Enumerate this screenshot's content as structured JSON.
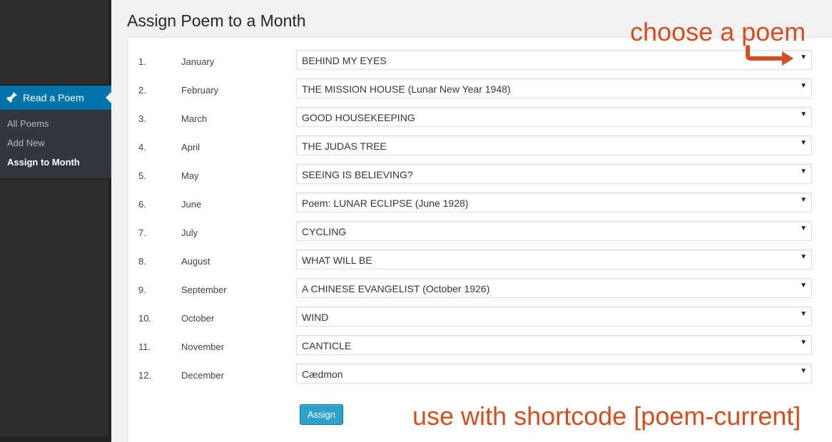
{
  "sidebar": {
    "menu_label": "Read a Poem",
    "submenu": [
      {
        "label": "All Poems"
      },
      {
        "label": "Add New"
      },
      {
        "label": "Assign to Month"
      }
    ]
  },
  "page": {
    "title": "Assign Poem to a Month",
    "assign_label": "Assign"
  },
  "rows": [
    {
      "num": "1.",
      "month": "January",
      "poem": "BEHIND MY EYES"
    },
    {
      "num": "2.",
      "month": "February",
      "poem": "THE MISSION HOUSE (Lunar New Year 1948)"
    },
    {
      "num": "3.",
      "month": "March",
      "poem": "GOOD HOUSEKEEPING"
    },
    {
      "num": "4.",
      "month": "April",
      "poem": "THE JUDAS TREE"
    },
    {
      "num": "5.",
      "month": "May",
      "poem": "SEEING IS BELIEVING?"
    },
    {
      "num": "6.",
      "month": "June",
      "poem": "Poem: LUNAR ECLIPSE (June 1928)"
    },
    {
      "num": "7.",
      "month": "July",
      "poem": "CYCLING"
    },
    {
      "num": "8.",
      "month": "August",
      "poem": "WHAT WILL BE"
    },
    {
      "num": "9.",
      "month": "September",
      "poem": "A CHINESE EVANGELIST (October 1926)"
    },
    {
      "num": "10.",
      "month": "October",
      "poem": "WIND"
    },
    {
      "num": "11.",
      "month": "November",
      "poem": "CANTICLE"
    },
    {
      "num": "12.",
      "month": "December",
      "poem": "Cædmon"
    }
  ],
  "annotations": {
    "choose": "choose a poem",
    "shortcode": "use with shortcode [poem-current]"
  },
  "colors": {
    "accent": "#0073aa",
    "button": "#2ea2cc",
    "annotation": "#d54e21"
  },
  "icons": {
    "menu": "pin-icon",
    "select": "dropdown-arrow-icon"
  }
}
